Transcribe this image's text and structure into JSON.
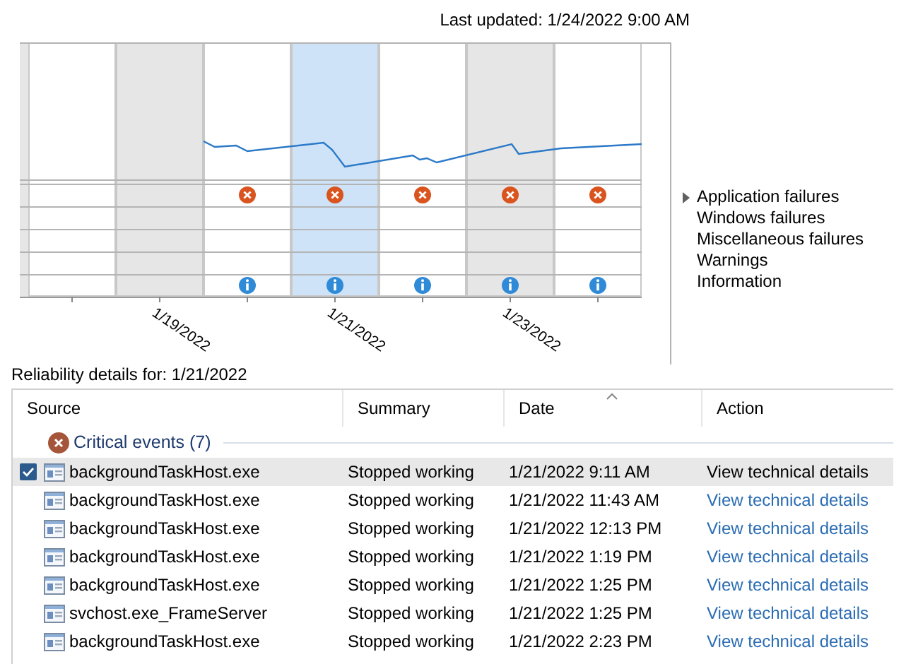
{
  "last_updated": "Last updated: 1/24/2022 9:00 AM",
  "chart": {
    "columns": [
      {
        "shaded": false,
        "selected": false,
        "application_failure": false,
        "information": false
      },
      {
        "shaded": true,
        "selected": false,
        "application_failure": false,
        "information": false,
        "date_label": "1/19/2022"
      },
      {
        "shaded": false,
        "selected": false,
        "application_failure": true,
        "information": true
      },
      {
        "shaded": false,
        "selected": true,
        "application_failure": true,
        "information": true,
        "date_label": "1/21/2022"
      },
      {
        "shaded": false,
        "selected": false,
        "application_failure": true,
        "information": true
      },
      {
        "shaded": true,
        "selected": false,
        "application_failure": true,
        "information": true,
        "date_label": "1/23/2022"
      },
      {
        "shaded": false,
        "selected": false,
        "application_failure": true,
        "information": true
      }
    ],
    "legend": [
      "Application failures",
      "Windows failures",
      "Miscellaneous failures",
      "Warnings",
      "Information"
    ]
  },
  "details": {
    "title": "Reliability details for: 1/21/2022",
    "columns": [
      {
        "label": "Source",
        "sorted": false
      },
      {
        "label": "Summary",
        "sorted": false
      },
      {
        "label": "Date",
        "sorted": true
      },
      {
        "label": "Action",
        "sorted": false
      }
    ],
    "group": {
      "label": "Critical events (7)",
      "rows": [
        {
          "source": "backgroundTaskHost.exe",
          "summary": "Stopped working",
          "date": "1/21/2022 9:11 AM",
          "action": "View technical details",
          "selected": true
        },
        {
          "source": "backgroundTaskHost.exe",
          "summary": "Stopped working",
          "date": "1/21/2022 11:43 AM",
          "action": "View technical details",
          "selected": false
        },
        {
          "source": "backgroundTaskHost.exe",
          "summary": "Stopped working",
          "date": "1/21/2022 12:13 PM",
          "action": "View technical details",
          "selected": false
        },
        {
          "source": "backgroundTaskHost.exe",
          "summary": "Stopped working",
          "date": "1/21/2022 1:19 PM",
          "action": "View technical details",
          "selected": false
        },
        {
          "source": "backgroundTaskHost.exe",
          "summary": "Stopped working",
          "date": "1/21/2022 1:25 PM",
          "action": "View technical details",
          "selected": false
        },
        {
          "source": "svchost.exe_FrameServer",
          "summary": "Stopped working",
          "date": "1/21/2022 1:25 PM",
          "action": "View technical details",
          "selected": false
        },
        {
          "source": "backgroundTaskHost.exe",
          "summary": "Stopped working",
          "date": "1/21/2022 2:23 PM",
          "action": "View technical details",
          "selected": false
        }
      ]
    }
  }
}
